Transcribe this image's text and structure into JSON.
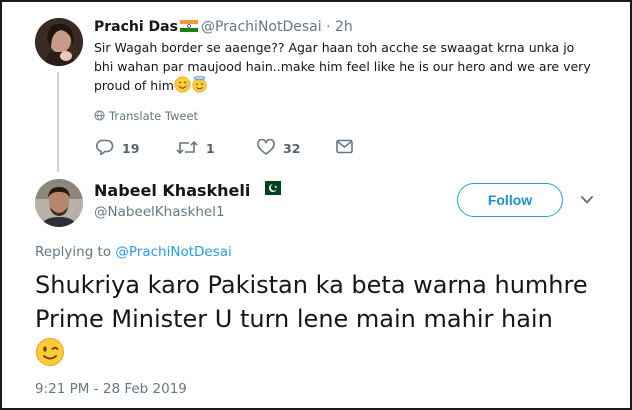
{
  "reply_tweet": {
    "display_name": "Prachi Das",
    "flag_icon": "india-flag-icon",
    "handle": "@PrachiNotDesai",
    "separator": "·",
    "time_ago": "2h",
    "text": "Sir Wagah border se aaenge?? Agar haan toh acche se swaagat krna unka jo bhi wahan par maujood hain..make him feel like he is our hero and we are very proud of him",
    "emojis": [
      "smiling-face-icon",
      "halo-face-icon"
    ],
    "translate_label": "Translate Tweet",
    "actions": {
      "reply_count": "19",
      "retweet_count": "1",
      "like_count": "32"
    }
  },
  "main_tweet": {
    "display_name": "Nabeel Khaskheli",
    "flag_icon": "pakistan-flag-icon",
    "handle": "@NabeelKhaskhel1",
    "follow_label": "Follow",
    "replying_prefix": "Replying to",
    "replying_handle": "@PrachiNotDesai",
    "text_line1": "Shukriya karo Pakistan ka beta warna humhre",
    "text_line2": "Prime Minister U turn lene main mahir hain",
    "emoji": "winking-face-icon",
    "timestamp": "9:21 PM - 28 Feb 2019"
  },
  "colors": {
    "accent": "#1da1f2",
    "muted": "#657786",
    "text": "#14171a",
    "thread_line": "#cdd5dc"
  }
}
